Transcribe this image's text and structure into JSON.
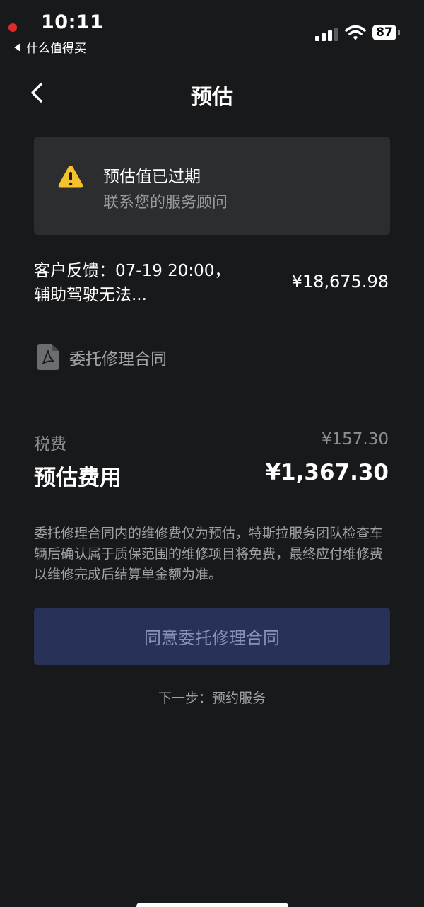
{
  "status_bar": {
    "time": "10:11",
    "back_app_label": "什么值得买",
    "battery_level": "87",
    "signal_strength_bars": 3
  },
  "nav": {
    "title": "预估"
  },
  "alert": {
    "title": "预估值已过期",
    "subtitle": "联系您的服务顾问"
  },
  "feedback": {
    "text": "客户反馈：07-19 20:00，辅助驾驶无法...",
    "amount": "¥18,675.98"
  },
  "contract": {
    "label": "委托修理合同"
  },
  "tax": {
    "label": "税费",
    "value": "¥157.30"
  },
  "total": {
    "label": "预估费用",
    "value": "¥1,367.30"
  },
  "disclaimer": "委托修理合同内的维修费仅为预估，特斯拉服务团队检查车辆后确认属于质保范围的维修项目将免费，最终应付维修费以维修完成后结算单金额为准。",
  "agree_button": {
    "label": "同意委托修理合同"
  },
  "next_step": "下一步：预约服务",
  "colors": {
    "background": "#18191b",
    "card": "#2c2d2f",
    "warning": "#f5c22b",
    "button_bg": "#283259",
    "button_text": "#8a93b3"
  },
  "icons": [
    "back-chevron-icon",
    "warning-icon",
    "pdf-icon",
    "signal-icon",
    "wifi-icon",
    "battery-icon",
    "recording-dot-icon"
  ]
}
